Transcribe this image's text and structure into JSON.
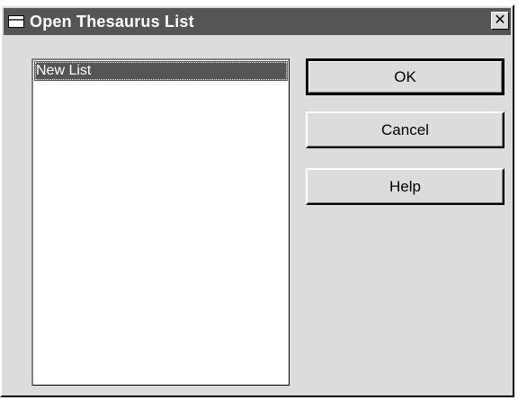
{
  "window": {
    "title": "Open Thesaurus List",
    "close_glyph": "✕"
  },
  "list": {
    "items": [
      "New List"
    ],
    "selected": "New List"
  },
  "buttons": {
    "ok": "OK",
    "cancel": "Cancel",
    "help": "Help"
  },
  "icons": {
    "system_menu": "window-menu-icon",
    "close": "close-icon"
  }
}
